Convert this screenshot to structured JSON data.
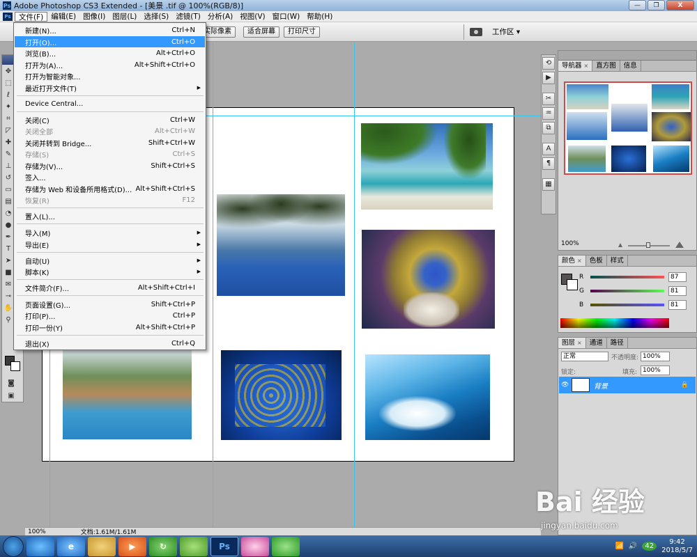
{
  "window": {
    "title": "Adobe Photoshop CS3 Extended - [美景 .tif @ 100%(RGB/8)]",
    "minimize": "—",
    "restore": "❐",
    "close": "X"
  },
  "menubar": {
    "items": [
      "文件(F)",
      "编辑(E)",
      "图像(I)",
      "图层(L)",
      "选择(S)",
      "滤镜(T)",
      "分析(A)",
      "视图(V)",
      "窗口(W)",
      "帮助(H)"
    ]
  },
  "options": {
    "actual_pixels": "实际像素",
    "fit_screen": "适合屏幕",
    "print_size": "打印尺寸",
    "workspace": "工作区 ▾"
  },
  "file_menu": {
    "items": [
      {
        "label": "新建(N)...",
        "shortcut": "Ctrl+N",
        "disabled": false,
        "selected": false,
        "submenu": false
      },
      {
        "label": "打开(O)...",
        "shortcut": "Ctrl+O",
        "disabled": false,
        "selected": true,
        "submenu": false
      },
      {
        "label": "浏览(B)...",
        "shortcut": "Alt+Ctrl+O",
        "disabled": false,
        "selected": false,
        "submenu": false
      },
      {
        "label": "打开为(A)...",
        "shortcut": "Alt+Shift+Ctrl+O",
        "disabled": false,
        "selected": false,
        "submenu": false
      },
      {
        "label": "打开为智能对象...",
        "shortcut": "",
        "disabled": false,
        "selected": false,
        "submenu": false
      },
      {
        "label": "最近打开文件(T)",
        "shortcut": "",
        "disabled": false,
        "selected": false,
        "submenu": true
      },
      {
        "label": "Device Central...",
        "shortcut": "",
        "disabled": false,
        "selected": false,
        "submenu": false
      },
      {
        "label": "关闭(C)",
        "shortcut": "Ctrl+W",
        "disabled": false,
        "selected": false,
        "submenu": false
      },
      {
        "label": "关闭全部",
        "shortcut": "Alt+Ctrl+W",
        "disabled": true,
        "selected": false,
        "submenu": false
      },
      {
        "label": "关闭并转到 Bridge...",
        "shortcut": "Shift+Ctrl+W",
        "disabled": false,
        "selected": false,
        "submenu": false
      },
      {
        "label": "存储(S)",
        "shortcut": "Ctrl+S",
        "disabled": true,
        "selected": false,
        "submenu": false
      },
      {
        "label": "存储为(V)...",
        "shortcut": "Shift+Ctrl+S",
        "disabled": false,
        "selected": false,
        "submenu": false
      },
      {
        "label": "签入...",
        "shortcut": "",
        "disabled": false,
        "selected": false,
        "submenu": false
      },
      {
        "label": "存储为 Web 和设备所用格式(D)...",
        "shortcut": "Alt+Shift+Ctrl+S",
        "disabled": false,
        "selected": false,
        "submenu": false
      },
      {
        "label": "恢复(R)",
        "shortcut": "F12",
        "disabled": true,
        "selected": false,
        "submenu": false
      },
      {
        "label": "置入(L)...",
        "shortcut": "",
        "disabled": false,
        "selected": false,
        "submenu": false
      },
      {
        "label": "导入(M)",
        "shortcut": "",
        "disabled": false,
        "selected": false,
        "submenu": true
      },
      {
        "label": "导出(E)",
        "shortcut": "",
        "disabled": false,
        "selected": false,
        "submenu": true
      },
      {
        "label": "自动(U)",
        "shortcut": "",
        "disabled": false,
        "selected": false,
        "submenu": true
      },
      {
        "label": "脚本(K)",
        "shortcut": "",
        "disabled": false,
        "selected": false,
        "submenu": true
      },
      {
        "label": "文件简介(F)...",
        "shortcut": "Alt+Shift+Ctrl+I",
        "disabled": false,
        "selected": false,
        "submenu": false
      },
      {
        "label": "页面设置(G)...",
        "shortcut": "Shift+Ctrl+P",
        "disabled": false,
        "selected": false,
        "submenu": false
      },
      {
        "label": "打印(P)...",
        "shortcut": "Ctrl+P",
        "disabled": false,
        "selected": false,
        "submenu": false
      },
      {
        "label": "打印一份(Y)",
        "shortcut": "Alt+Shift+Ctrl+P",
        "disabled": false,
        "selected": false,
        "submenu": false
      },
      {
        "label": "退出(X)",
        "shortcut": "Ctrl+Q",
        "disabled": false,
        "selected": false,
        "submenu": false
      }
    ]
  },
  "navigator_panel": {
    "tabs": [
      "导航器",
      "直方图",
      "信息"
    ],
    "zoom": "100%"
  },
  "color_panel": {
    "tabs": [
      "颜色",
      "色板",
      "样式"
    ],
    "r_label": "R",
    "r_value": "87",
    "g_label": "G",
    "g_value": "81",
    "b_label": "B",
    "b_value": "81"
  },
  "layers_panel": {
    "tabs": [
      "图层",
      "通道",
      "路径"
    ],
    "blend_mode": "正常",
    "opacity_label": "不透明度:",
    "opacity_value": "100%",
    "lock_label": "锁定:",
    "fill_label": "填充:",
    "fill_value": "100%",
    "layer_name": "背景"
  },
  "status": {
    "zoom": "100%",
    "doc_info": "文档:1.61M/1.61M"
  },
  "taskbar": {
    "time": "9:42",
    "date": "2018/5/7",
    "badge": "42",
    "ps_label": "Ps"
  },
  "watermark": {
    "main": "Bai 经验",
    "sub": "jingyan.baidu.com"
  },
  "colors": {
    "menu_highlight": "#3399ff",
    "guide": "#34c8ee",
    "nav_frame": "#d04848"
  }
}
